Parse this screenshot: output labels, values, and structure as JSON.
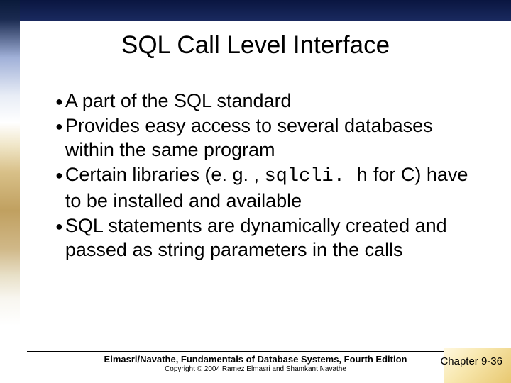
{
  "title": "SQL Call Level Interface",
  "bullets": [
    {
      "plain": "A part of the SQL standard"
    },
    {
      "plain": "Provides easy access to several databases within the same program"
    },
    {
      "pre": "Certain libraries (e. g. , ",
      "code": "sqlcli. h",
      "post": " for C) have to be installed and available"
    },
    {
      "plain": "SQL statements are dynamically created and passed as string parameters in the calls"
    }
  ],
  "footer": {
    "main": "Elmasri/Navathe, Fundamentals of Database Systems, Fourth Edition",
    "sub": "Copyright © 2004 Ramez Elmasri and Shamkant Navathe"
  },
  "chapter": "Chapter 9-36"
}
